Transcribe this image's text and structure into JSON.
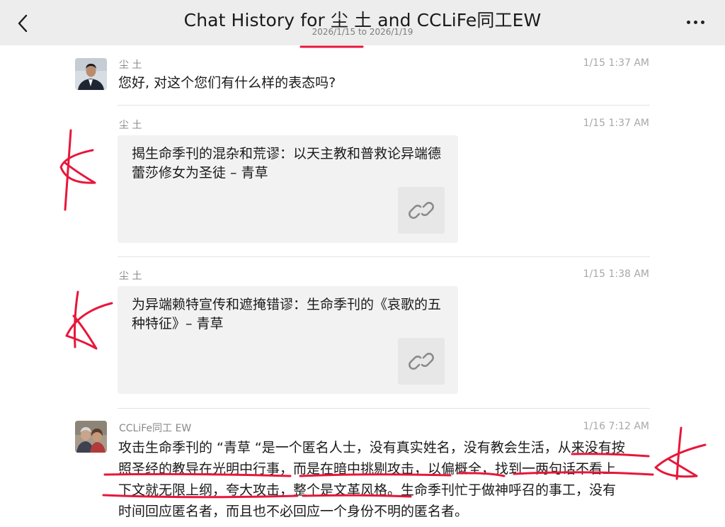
{
  "header": {
    "title": "Chat History for 尘  土 and CCLiFe同工EW",
    "date_range": "2026/1/15 to 2026/1/19",
    "back_icon": "chevron-left-icon",
    "more_icon": "more-dots-icon"
  },
  "messages": [
    {
      "sender": "尘  土",
      "time": "1/15 1:37 AM",
      "text": "您好, 对这个您们有什么样的表态吗?"
    },
    {
      "sender": "尘  土",
      "time": "1/15 1:37 AM",
      "link_title": "揭生命季刊的混杂和荒谬：以天主教和普救论异端德蕾莎修女为圣徒 – 青草",
      "icon": "link-icon"
    },
    {
      "sender": "尘  土",
      "time": "1/15 1:38 AM",
      "link_title": "为异端赖特宣传和遮掩错谬：生命季刊的《哀歌的五种特征》– 青草",
      "icon": "link-icon"
    },
    {
      "sender": "CCLiFe同工 EW",
      "time": "1/16 7:12 AM",
      "lines": [
        "攻击生命季刊的 “青草 “是一个匿名人士，没有真实姓名，没有教会生活，从来没有按",
        "照圣经的教导在光明中行事，而是在暗中挑剔攻击，以偏概全，找到一两句话不看上",
        "下文就无限上纲，夸大攻击，整个是文革风格。生命季刊忙于做神呼召的事工，没有",
        "时间回应匿名者，而且也不必回应一个身份不明的匿名者。"
      ]
    }
  ],
  "annotation_color": "#e8163a"
}
